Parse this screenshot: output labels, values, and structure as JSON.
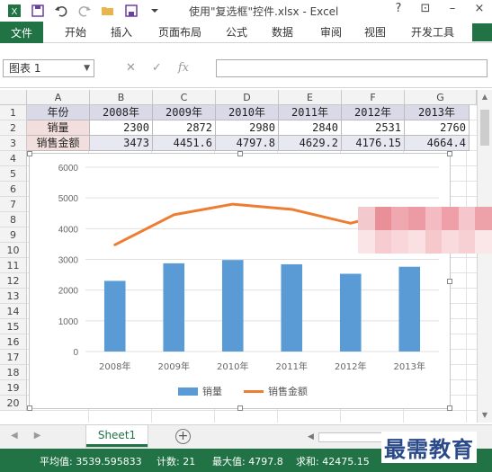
{
  "window": {
    "title": "使用\"复选框\"控件.xlsx - Excel",
    "controls": [
      "?",
      "⊡",
      "–",
      "×"
    ]
  },
  "qat": {
    "icons": [
      "excel-logo-icon",
      "save-icon",
      "undo-icon",
      "redo-icon",
      "open-folder-icon",
      "save-as-icon",
      "customize-icon"
    ]
  },
  "ribbon": {
    "file_tab": "文件",
    "tabs": [
      "开始",
      "插入",
      "页面布局",
      "公式",
      "数据",
      "审阅",
      "视图",
      "开发工具"
    ]
  },
  "formula_bar": {
    "name_box": "图表 1",
    "cancel": "✕",
    "enter": "✓",
    "fx": "fx",
    "value": ""
  },
  "columns": [
    "A",
    "B",
    "C",
    "D",
    "E",
    "F",
    "G"
  ],
  "rows": [
    "1",
    "2",
    "3",
    "4",
    "5",
    "6",
    "7",
    "8",
    "9",
    "10",
    "11",
    "12",
    "13",
    "14",
    "15",
    "16",
    "17",
    "18",
    "19",
    "20"
  ],
  "table": {
    "header_label": "年份",
    "years": [
      "2008年",
      "2009年",
      "2010年",
      "2011年",
      "2012年",
      "2013年"
    ],
    "row2_label": "销量",
    "row2_values": [
      "2300",
      "2872",
      "2980",
      "2840",
      "2531",
      "2760"
    ],
    "row3_label": "销售金额",
    "row3_values": [
      "3473",
      "4451.6",
      "4797.8",
      "4629.2",
      "4176.15",
      "4664.4"
    ]
  },
  "chart_data": {
    "type": "bar",
    "categories": [
      "2008年",
      "2009年",
      "2010年",
      "2011年",
      "2012年",
      "2013年"
    ],
    "series": [
      {
        "name": "销量",
        "type": "bar",
        "values": [
          2300,
          2872,
          2980,
          2840,
          2531,
          2760
        ]
      },
      {
        "name": "销售金额",
        "type": "line",
        "values": [
          3473,
          4451.6,
          4797.8,
          4629.2,
          4176.15,
          4664.4
        ]
      }
    ],
    "ylim": [
      0,
      6000
    ],
    "yticks": [
      "0",
      "1000",
      "2000",
      "3000",
      "4000",
      "5000",
      "6000"
    ],
    "grid": true,
    "legend": "bottom",
    "colors": {
      "bar": "#5b9bd5",
      "line": "#ed7d31"
    }
  },
  "sheets": {
    "active": "Sheet1",
    "add_label": "+"
  },
  "status": {
    "average": "平均值: 3539.595833",
    "count": "计数: 21",
    "max": "最大值: 4797.8",
    "sum": "求和: 42475.15"
  },
  "watermark": "最需教育",
  "colors": {
    "excel_green": "#217346"
  }
}
